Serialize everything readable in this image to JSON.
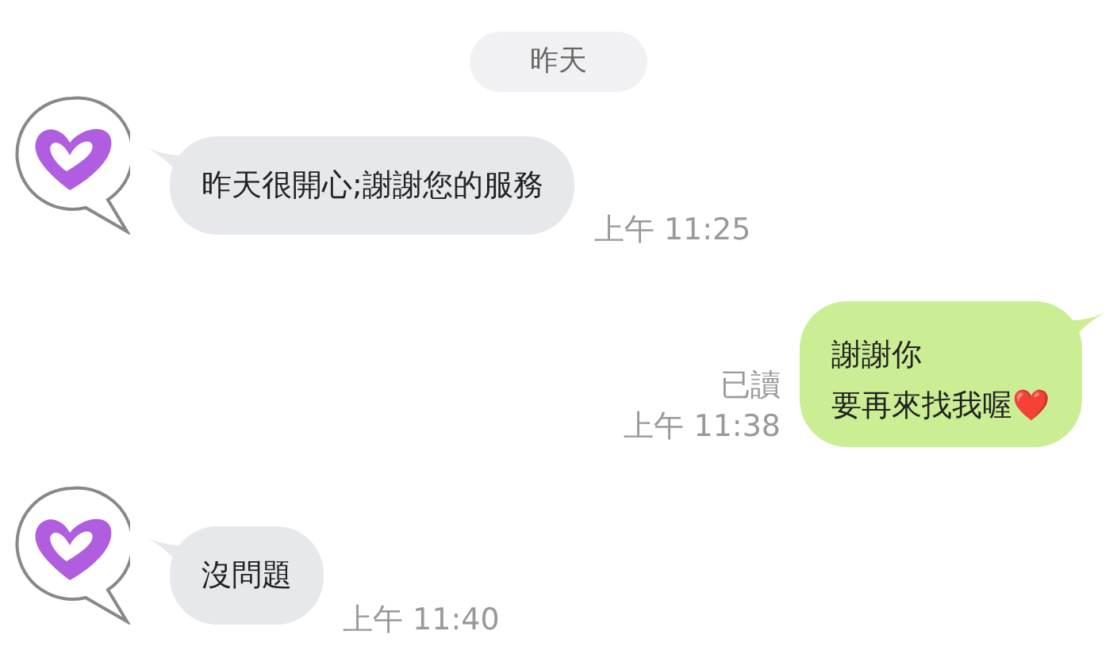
{
  "date_divider": "昨天",
  "messages": [
    {
      "kind": "incoming",
      "lines": [
        "昨天很開心;謝謝您的服務"
      ],
      "time": "上午 11:25"
    },
    {
      "kind": "outgoing",
      "lines": [
        "謝謝你",
        "要再來找我喔❤️"
      ],
      "read": "已讀",
      "time": "上午 11:38"
    },
    {
      "kind": "incoming",
      "lines": [
        "沒問題"
      ],
      "time": "上午 11:40"
    }
  ]
}
